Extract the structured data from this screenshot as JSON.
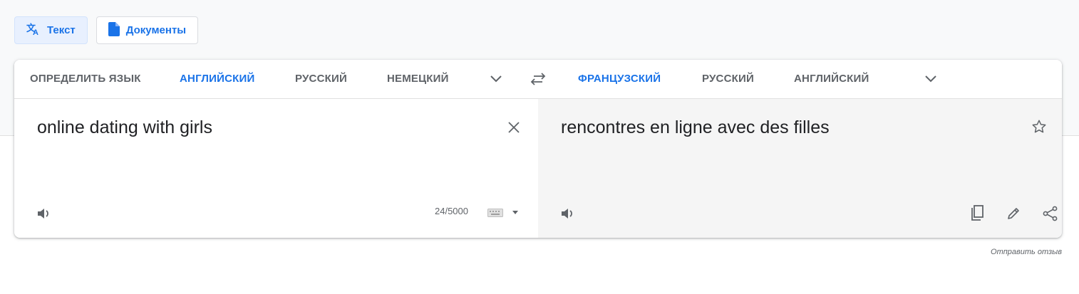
{
  "mode_tabs": {
    "text_label": "Текст",
    "documents_label": "Документы"
  },
  "source_languages": {
    "detect": "ОПРЕДЕЛИТЬ ЯЗЫК",
    "items": [
      "АНГЛИЙСКИЙ",
      "РУССКИЙ",
      "НЕМЕЦКИЙ"
    ],
    "selected": "АНГЛИЙСКИЙ"
  },
  "target_languages": {
    "items": [
      "ФРАНЦУЗСКИЙ",
      "РУССКИЙ",
      "АНГЛИЙСКИЙ"
    ],
    "selected": "ФРАНЦУЗСКИЙ"
  },
  "source": {
    "text": "online dating with girls",
    "char_count": "24/5000"
  },
  "target": {
    "text": "rencontres en ligne avec des filles"
  },
  "footer": {
    "feedback": "Отправить отзыв"
  },
  "colors": {
    "accent": "#1a73e8",
    "muted": "#5f6368",
    "target_bg": "#f5f5f5"
  }
}
